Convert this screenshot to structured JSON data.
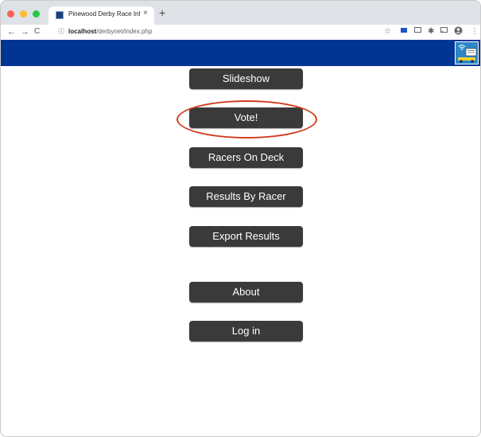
{
  "browser": {
    "tab_title": "Pinewood Derby Race Informati",
    "tab_close": "×",
    "new_tab": "+",
    "back": "←",
    "forward": "→",
    "reload": "C",
    "info": "ⓘ",
    "url_host": "localhost",
    "url_path": "/derbynet/index.php",
    "icons": [
      "star-icon",
      "extension-icon",
      "cast-icon",
      "puzzle-icon",
      "media-icon",
      "profile-icon",
      "menu-icon"
    ],
    "traffic_lights": {
      "close": "#fe5f57",
      "minimize": "#febc2e",
      "maximize": "#28c840"
    }
  },
  "page": {
    "banner_color": "#003594",
    "buttons": [
      {
        "label": "Slideshow"
      },
      {
        "label": "Vote!"
      },
      {
        "label": "Racers On Deck"
      },
      {
        "label": "Results By Racer"
      },
      {
        "label": "Export Results"
      },
      {
        "label": "About"
      },
      {
        "label": "Log in"
      }
    ],
    "highlight_color": "#d23a1c"
  }
}
